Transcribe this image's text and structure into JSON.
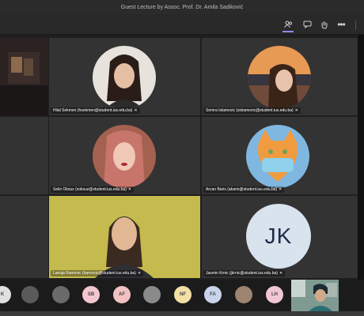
{
  "window": {
    "title": "Guest Lecture by Assoc. Prof. Dr. Amila Sadiković"
  },
  "toolbar": {
    "people_icon": "people-icon",
    "chat_icon": "chat-icon",
    "hand_icon": "raise-hand-icon",
    "more_label": "•••"
  },
  "participants": [
    {
      "name": "Hilal Sekmen (hsekmen@student.ius.edu.ba)"
    },
    {
      "name": "Semra Islamovic (sislamovic@student.ius.edu.ba)"
    },
    {
      "name": "Selin Oksuz (soksuz@student.ius.edu.ba)"
    },
    {
      "name": "Arcan Baris (abaris@student.ius.edu.ba)"
    },
    {
      "name": "Lamija Ramovic (lramovic@student.ius.edu.ba)"
    },
    {
      "name": "Jasmin Krnic (jkrnic@student.ius.edu.ba)",
      "initials": "JK"
    }
  ],
  "gallery": [
    {
      "initials": "K",
      "color": "#e0e0e0"
    },
    {
      "initials": "",
      "color": "#5a5a5a"
    },
    {
      "initials": "",
      "color": "#6a6a6a"
    },
    {
      "initials": "SB",
      "color": "#f3c7cf"
    },
    {
      "initials": "AF",
      "color": "#f2c2c2"
    },
    {
      "initials": "",
      "color": "#8a8a8a"
    },
    {
      "initials": "NF",
      "color": "#f2e0a6"
    },
    {
      "initials": "FA",
      "color": "#c9d4ec"
    },
    {
      "initials": "",
      "color": "#9c8470"
    },
    {
      "initials": "LH",
      "color": "#f2c7d5"
    }
  ],
  "colors": {
    "accent": "#8a8ee6",
    "background": "#1f1f1f",
    "tile": "#333333"
  }
}
